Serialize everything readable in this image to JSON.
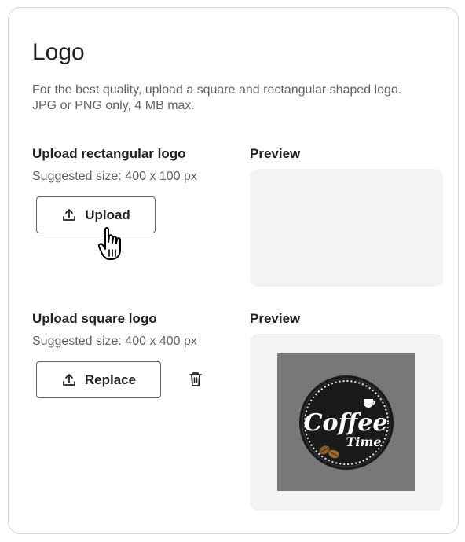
{
  "section": {
    "title": "Logo",
    "description": "For the best quality, upload a square and rectangular shaped logo. JPG or PNG only, 4 MB max."
  },
  "rectangular": {
    "heading": "Upload rectangular logo",
    "suggested": "Suggested size: 400 x 100 px",
    "button_label": "Upload",
    "preview_label": "Preview"
  },
  "square": {
    "heading": "Upload square logo",
    "suggested": "Suggested size: 400 x 400 px",
    "button_label": "Replace",
    "preview_label": "Preview",
    "logo_text_main": "Coffee",
    "logo_text_sub": "Time"
  },
  "icons": {
    "upload": "upload-icon",
    "trash": "trash-icon",
    "cursor": "hand-pointer-cursor"
  },
  "colors": {
    "preview_bg": "#f3f3f3",
    "logo_bg": "#77787a",
    "text_primary": "#202124",
    "text_secondary": "#5f6368"
  }
}
